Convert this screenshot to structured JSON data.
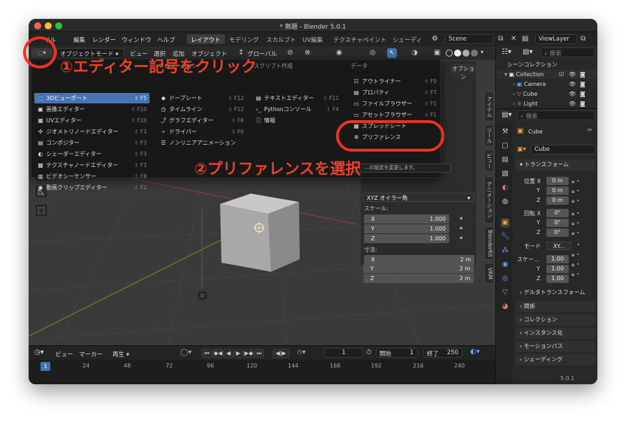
{
  "window": {
    "title": "* 無題 - Blender 5.0.1",
    "version": "5.0.1"
  },
  "menubar": {
    "items": [
      "イル",
      "編集",
      "レンダー",
      "ウィンドウ",
      "ヘルプ"
    ],
    "workspaces": [
      "レイアウト",
      "モデリング",
      "スカルプト",
      "UV編集",
      "テクスチャペイント",
      "シェーディ"
    ],
    "active_workspace": "レイアウト",
    "scene": "Scene",
    "viewlayer": "ViewLayer"
  },
  "viewport_header": {
    "mode": "オブジェクトモード",
    "menus": [
      "ビュー",
      "選択",
      "追加",
      "オブジェクト"
    ],
    "transform": "グローバル",
    "options": "オプション"
  },
  "editor_menu": {
    "col1": [
      {
        "label": "3Dビューポート",
        "shortcut": "⇧ F5",
        "icon": "viewport-icon",
        "glyph": "⬚",
        "highlight": true
      },
      {
        "label": "画像エディター",
        "shortcut": "⇧ F10",
        "icon": "image-icon",
        "glyph": "▣"
      },
      {
        "label": "UVエディター",
        "shortcut": "⇧ F10",
        "icon": "uv-icon",
        "glyph": "▦"
      },
      {
        "label": "ジオメトリノードエディター",
        "shortcut": "⇧ F3",
        "icon": "geometry-nodes-icon",
        "glyph": "✣"
      },
      {
        "label": "コンポジター",
        "shortcut": "⇧ F3",
        "icon": "compositor-icon",
        "glyph": "▤"
      },
      {
        "label": "シェーダーエディター",
        "shortcut": "⇧ F3",
        "icon": "shader-icon",
        "glyph": "◐"
      },
      {
        "label": "テクスチャノードエディター",
        "shortcut": "⇧ F3",
        "icon": "texture-icon",
        "glyph": "▩"
      },
      {
        "label": "ビデオシーケンサー",
        "shortcut": "⇧ F8",
        "icon": "sequencer-icon",
        "glyph": "▥"
      },
      {
        "label": "動画クリップエディター",
        "shortcut": "⇧ F2",
        "icon": "clip-icon",
        "glyph": "◉"
      }
    ],
    "col2_head": "アニメーション",
    "col2": [
      {
        "label": "ドープシート",
        "shortcut": "⇧ F12",
        "icon": "dopesheet-icon",
        "glyph": "◆"
      },
      {
        "label": "タイムライン",
        "shortcut": "⇧ F12",
        "icon": "timeline-icon",
        "glyph": "◷"
      },
      {
        "label": "グラフエディター",
        "shortcut": "⇧ F6",
        "icon": "graph-icon",
        "glyph": "⤴"
      },
      {
        "label": "ドライバー",
        "shortcut": "⇧ F6",
        "icon": "driver-icon",
        "glyph": "⌁"
      },
      {
        "label": "ノンリニアアニメーション",
        "shortcut": "",
        "icon": "nla-icon",
        "glyph": "☰"
      }
    ],
    "col3_head": "スクリプト作成",
    "col3": [
      {
        "label": "テキストエディター",
        "shortcut": "⇧ F11",
        "icon": "text-icon",
        "glyph": "▤"
      },
      {
        "label": "Pythonコンソール",
        "shortcut": "⇧ F4",
        "icon": "console-icon",
        "glyph": "›_"
      },
      {
        "label": "情報",
        "shortcut": "",
        "icon": "info-icon",
        "glyph": "ⓘ"
      }
    ],
    "col4_head": "データ",
    "col4": [
      {
        "label": "アウトライナー",
        "shortcut": "⇧ F9",
        "icon": "outliner-icon",
        "glyph": "☷"
      },
      {
        "label": "プロパティ",
        "shortcut": "⇧ F7",
        "icon": "properties-icon",
        "glyph": "▤"
      },
      {
        "label": "ファイルブラウザー",
        "shortcut": "⇧ F1",
        "icon": "file-browser-icon",
        "glyph": "▭"
      },
      {
        "label": "アセットブラウザー",
        "shortcut": "⇧ F1",
        "icon": "asset-browser-icon",
        "glyph": "▭"
      },
      {
        "label": "スプレッドシート",
        "shortcut": "",
        "icon": "spreadsheet-icon",
        "glyph": "▦"
      },
      {
        "label": "プリファレンス",
        "shortcut": "",
        "icon": "preferences-icon",
        "glyph": "✲"
      }
    ],
    "tooltip": "...の設定を変更します。"
  },
  "npanel": {
    "tabs": [
      "アイテム",
      "ツール",
      "ビュー",
      "アニメーション",
      "BlenderKit",
      "VRM"
    ],
    "rotation_mode": "XYZ オイラー角",
    "scale_label": "スケール:",
    "scale": [
      {
        "axis": "X",
        "value": "1.000"
      },
      {
        "axis": "Y",
        "value": "1.000"
      },
      {
        "axis": "Z",
        "value": "1.000"
      }
    ],
    "dimensions_label": "寸法:",
    "dimensions": [
      {
        "axis": "X",
        "value": "2 m"
      },
      {
        "axis": "Y",
        "value": "2 m"
      },
      {
        "axis": "Z",
        "value": "2 m"
      }
    ]
  },
  "timeline": {
    "menus": [
      "ビュー",
      "マーカー"
    ],
    "playback": "再生",
    "current_frame": "1",
    "start_label": "開始",
    "start": "1",
    "end_label": "終了",
    "end": "250",
    "ticks": [
      "1",
      "24",
      "48",
      "72",
      "96",
      "120",
      "144",
      "168",
      "192",
      "216",
      "240"
    ]
  },
  "outliner": {
    "search_placeholder": "検索",
    "scene_collection": "シーンコレクション",
    "items": [
      {
        "name": "Collection",
        "icon": "collection-icon"
      },
      {
        "name": "Camera",
        "icon": "camera-icon"
      },
      {
        "name": "Cube",
        "icon": "cube-icon"
      },
      {
        "name": "Light",
        "icon": "light-icon"
      }
    ]
  },
  "properties": {
    "search_placeholder": "検索",
    "object_name": "Cube",
    "object_field": "Cube",
    "transform_label": "トランスフォーム",
    "location_label": "位置 X",
    "location": [
      "0 m",
      "0 m",
      "0 m"
    ],
    "rotation_label": "回転 X",
    "rotation": [
      "0°",
      "0°",
      "0°"
    ],
    "mode_label": "モード",
    "mode_value": "XY...",
    "scale_label": "スケー...",
    "scale": [
      "1.00",
      "1.00",
      "1.00"
    ],
    "axes": [
      "X",
      "Y",
      "Z"
    ],
    "delta_transform": "デルタトランスフォーム",
    "sections": [
      "関係",
      "コレクション",
      "インスタンス化",
      "モーションパス",
      "シェーディング"
    ]
  },
  "annotations": {
    "step1": "①エディター記号をクリック",
    "step2": "②プリファレンスを選択",
    "color": "#e8432d"
  }
}
